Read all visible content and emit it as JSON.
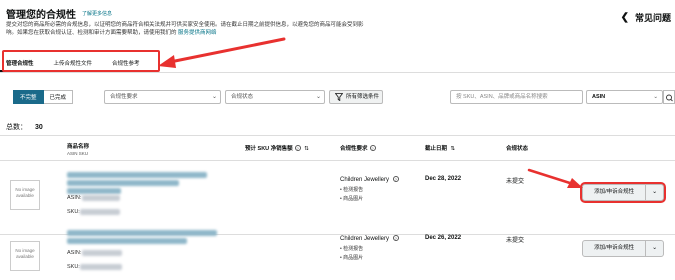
{
  "header": {
    "title": "管理您的合规性",
    "learn_more": "了解更多信息",
    "description": "提交对您的商品所必需的合规信息，以证明您的商品符合相关法规并可供买家安全使用。请在截止日期之前提供信息，以避免您的商品可能会受到影响。如果您在获取合规认证、检测和审计方面需要帮助，请使用我们的",
    "description_link": "服务提供商网络",
    "faq": "常见问题"
  },
  "tabs": [
    {
      "label": "管理合规性",
      "active": true
    },
    {
      "label": "上传合规性文件",
      "active": false
    },
    {
      "label": "合规性参考",
      "active": false
    }
  ],
  "filters": {
    "seg_on": "不完整",
    "seg_off": "已完成",
    "requirement_placeholder": "合规性要求",
    "status_placeholder": "合规状态",
    "all_filters": "所有筛选条件",
    "search_placeholder": "按 SKU、ASIN、品牌或商品名称搜索",
    "search_type": "ASIN"
  },
  "total": {
    "label": "总数：",
    "value": "30"
  },
  "columns": {
    "product": "商品名称",
    "product_sub": "ASIN  SKU",
    "sales": "预计 SKU 净销售额",
    "requirement": "合规性要求",
    "deadline": "截止日期",
    "status": "合规状态"
  },
  "rows": [
    {
      "image_text": "No image available",
      "asin_label": "ASIN:",
      "sku_label": "SKU:",
      "requirement": "Children Jewellery",
      "req_items": [
        "检测报告",
        "商品图片"
      ],
      "deadline": "Dec 28, 2022",
      "status": "未提交",
      "action": "添加/申诉合规性"
    },
    {
      "image_text": "No image available",
      "asin_label": "ASIN:",
      "sku_label": "SKU:",
      "requirement": "Children Jewellery",
      "req_items": [
        "检测报告",
        "商品图片"
      ],
      "deadline": "Dec 26, 2022",
      "status": "未提交",
      "action": "添加/申诉合规性"
    }
  ],
  "colors": {
    "accent": "#1a6a8a",
    "annotation": "#e8312f",
    "link": "#007185"
  }
}
